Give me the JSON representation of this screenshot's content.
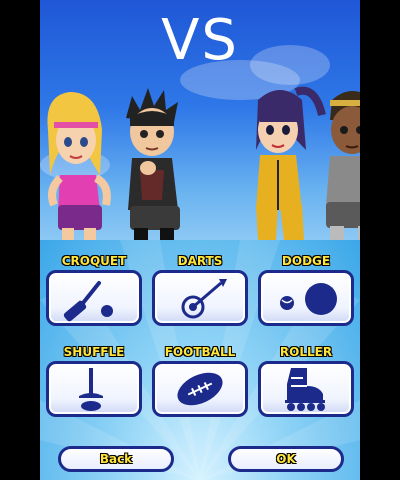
{
  "header": {
    "title": "VS"
  },
  "characters": [
    {
      "name": "blonde-girl-pink-top",
      "side": "left"
    },
    {
      "name": "spiky-hair-boy-black-shirt",
      "side": "left"
    },
    {
      "name": "dark-hair-girl-yellow-suit",
      "side": "right"
    },
    {
      "name": "dreadlocks-boy-grey-shirt",
      "side": "right"
    }
  ],
  "games": [
    {
      "label": "CROQUET",
      "icon": "croquet-mallet-icon"
    },
    {
      "label": "DARTS",
      "icon": "dart-target-icon"
    },
    {
      "label": "DODGE",
      "icon": "dodgeball-icon"
    },
    {
      "label": "SHUFFLE",
      "icon": "shuffleboard-cue-icon"
    },
    {
      "label": "FOOTBALL",
      "icon": "football-icon"
    },
    {
      "label": "ROLLER",
      "icon": "roller-skate-icon"
    }
  ],
  "buttons": {
    "back": "Back",
    "ok": "OK"
  },
  "colors": {
    "label_yellow": "#ffe53b",
    "tile_border": "#1c2a8c",
    "icon_blue": "#1c2a8c"
  }
}
